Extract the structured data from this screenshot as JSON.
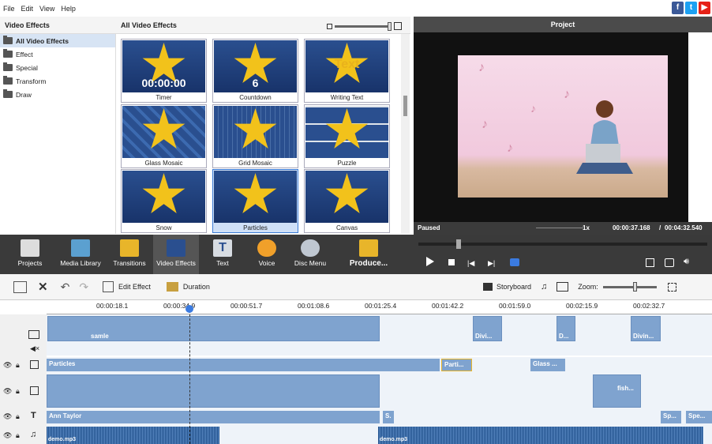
{
  "menu": [
    "File",
    "Edit",
    "View",
    "Help"
  ],
  "social": [
    {
      "label": "f",
      "color": "#3b5998"
    },
    {
      "label": "t",
      "color": "#1da1f2"
    },
    {
      "label": "▶",
      "color": "#e62117"
    }
  ],
  "left_panel": {
    "title": "Video Effects",
    "items": [
      {
        "label": "All Video Effects",
        "selected": true
      },
      {
        "label": "Effect"
      },
      {
        "label": "Special"
      },
      {
        "label": "Transform"
      },
      {
        "label": "Draw"
      }
    ]
  },
  "effects_panel": {
    "title": "All Video Effects",
    "tiles": [
      {
        "label": "Timer",
        "overlay": "00:00:00"
      },
      {
        "label": "Countdown",
        "overlay": "6"
      },
      {
        "label": "Writing Text",
        "overlay": "Text"
      },
      {
        "label": "Glass Mosaic"
      },
      {
        "label": "Grid Mosaic"
      },
      {
        "label": "Puzzle"
      },
      {
        "label": "Snow"
      },
      {
        "label": "Particles",
        "selected": true
      },
      {
        "label": "Canvas"
      }
    ]
  },
  "preview": {
    "title": "Project",
    "status": "Paused",
    "speed": "1x",
    "current_time": "00:00:37.168",
    "total_time": "00:04:32.540"
  },
  "toolbar": {
    "tools": [
      {
        "label": "Projects",
        "icon": "clapper-icon"
      },
      {
        "label": "Media Library",
        "icon": "film-icon"
      },
      {
        "label": "Transitions",
        "icon": "transitions-icon"
      },
      {
        "label": "Video Effects",
        "icon": "star-icon",
        "selected": true
      },
      {
        "label": "Text",
        "icon": "text-icon"
      },
      {
        "label": "Voice",
        "icon": "microphone-icon"
      },
      {
        "label": "Disc Menu",
        "icon": "disc-icon"
      },
      {
        "label": "Produce...",
        "icon": "produce-icon"
      }
    ]
  },
  "edit_toolbar": {
    "edit_effect": "Edit Effect",
    "duration": "Duration",
    "storyboard": "Storyboard",
    "zoom": "Zoom:"
  },
  "timeline": {
    "ruler": [
      "00:00:18.1",
      "00:00:34.9",
      "00:00:51.7",
      "00:01:08.6",
      "00:01:25.4",
      "00:01:42.2",
      "00:01:59.0",
      "00:02:15.9",
      "00:02:32.7"
    ],
    "video_clips": [
      "samle",
      "Divi...",
      "D...",
      "Divin..."
    ],
    "effect_bars": [
      "Particles",
      "Parti...",
      "Glass ..."
    ],
    "overlay_clips": [
      "fish..."
    ],
    "text_bars": [
      "Ann Taylor",
      "S.",
      "Sp...",
      "Spe..."
    ],
    "audio_clips": [
      "demo.mp3",
      "demo.mp3"
    ]
  },
  "colors": {
    "accent": "#3b7be0",
    "toolbar_bg": "#3a3a3a",
    "clip": "#7fa3cf",
    "star": "#f2c21b"
  }
}
